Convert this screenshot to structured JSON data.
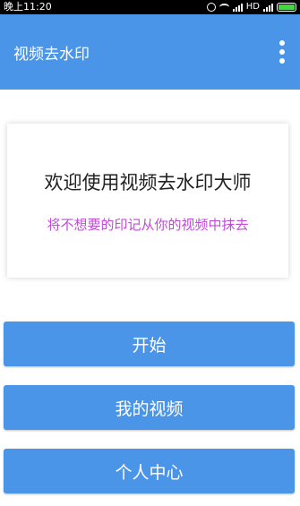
{
  "status_bar": {
    "time": "晚上11:20",
    "network": "HD",
    "icons": [
      "alarm-icon",
      "wifi-icon",
      "signal-icon",
      "signal-icon",
      "battery-icon"
    ]
  },
  "app_bar": {
    "title": "视频去水印",
    "menu_icon": "more-vert-icon"
  },
  "welcome": {
    "title": "欢迎使用视频去水印大师",
    "subtitle": "将不想要的印记从你的视频中抹去"
  },
  "buttons": {
    "start": "开始",
    "my_videos": "我的视频",
    "profile": "个人中心"
  },
  "colors": {
    "primary": "#4a95e8",
    "subtitle": "#c04bd6"
  }
}
